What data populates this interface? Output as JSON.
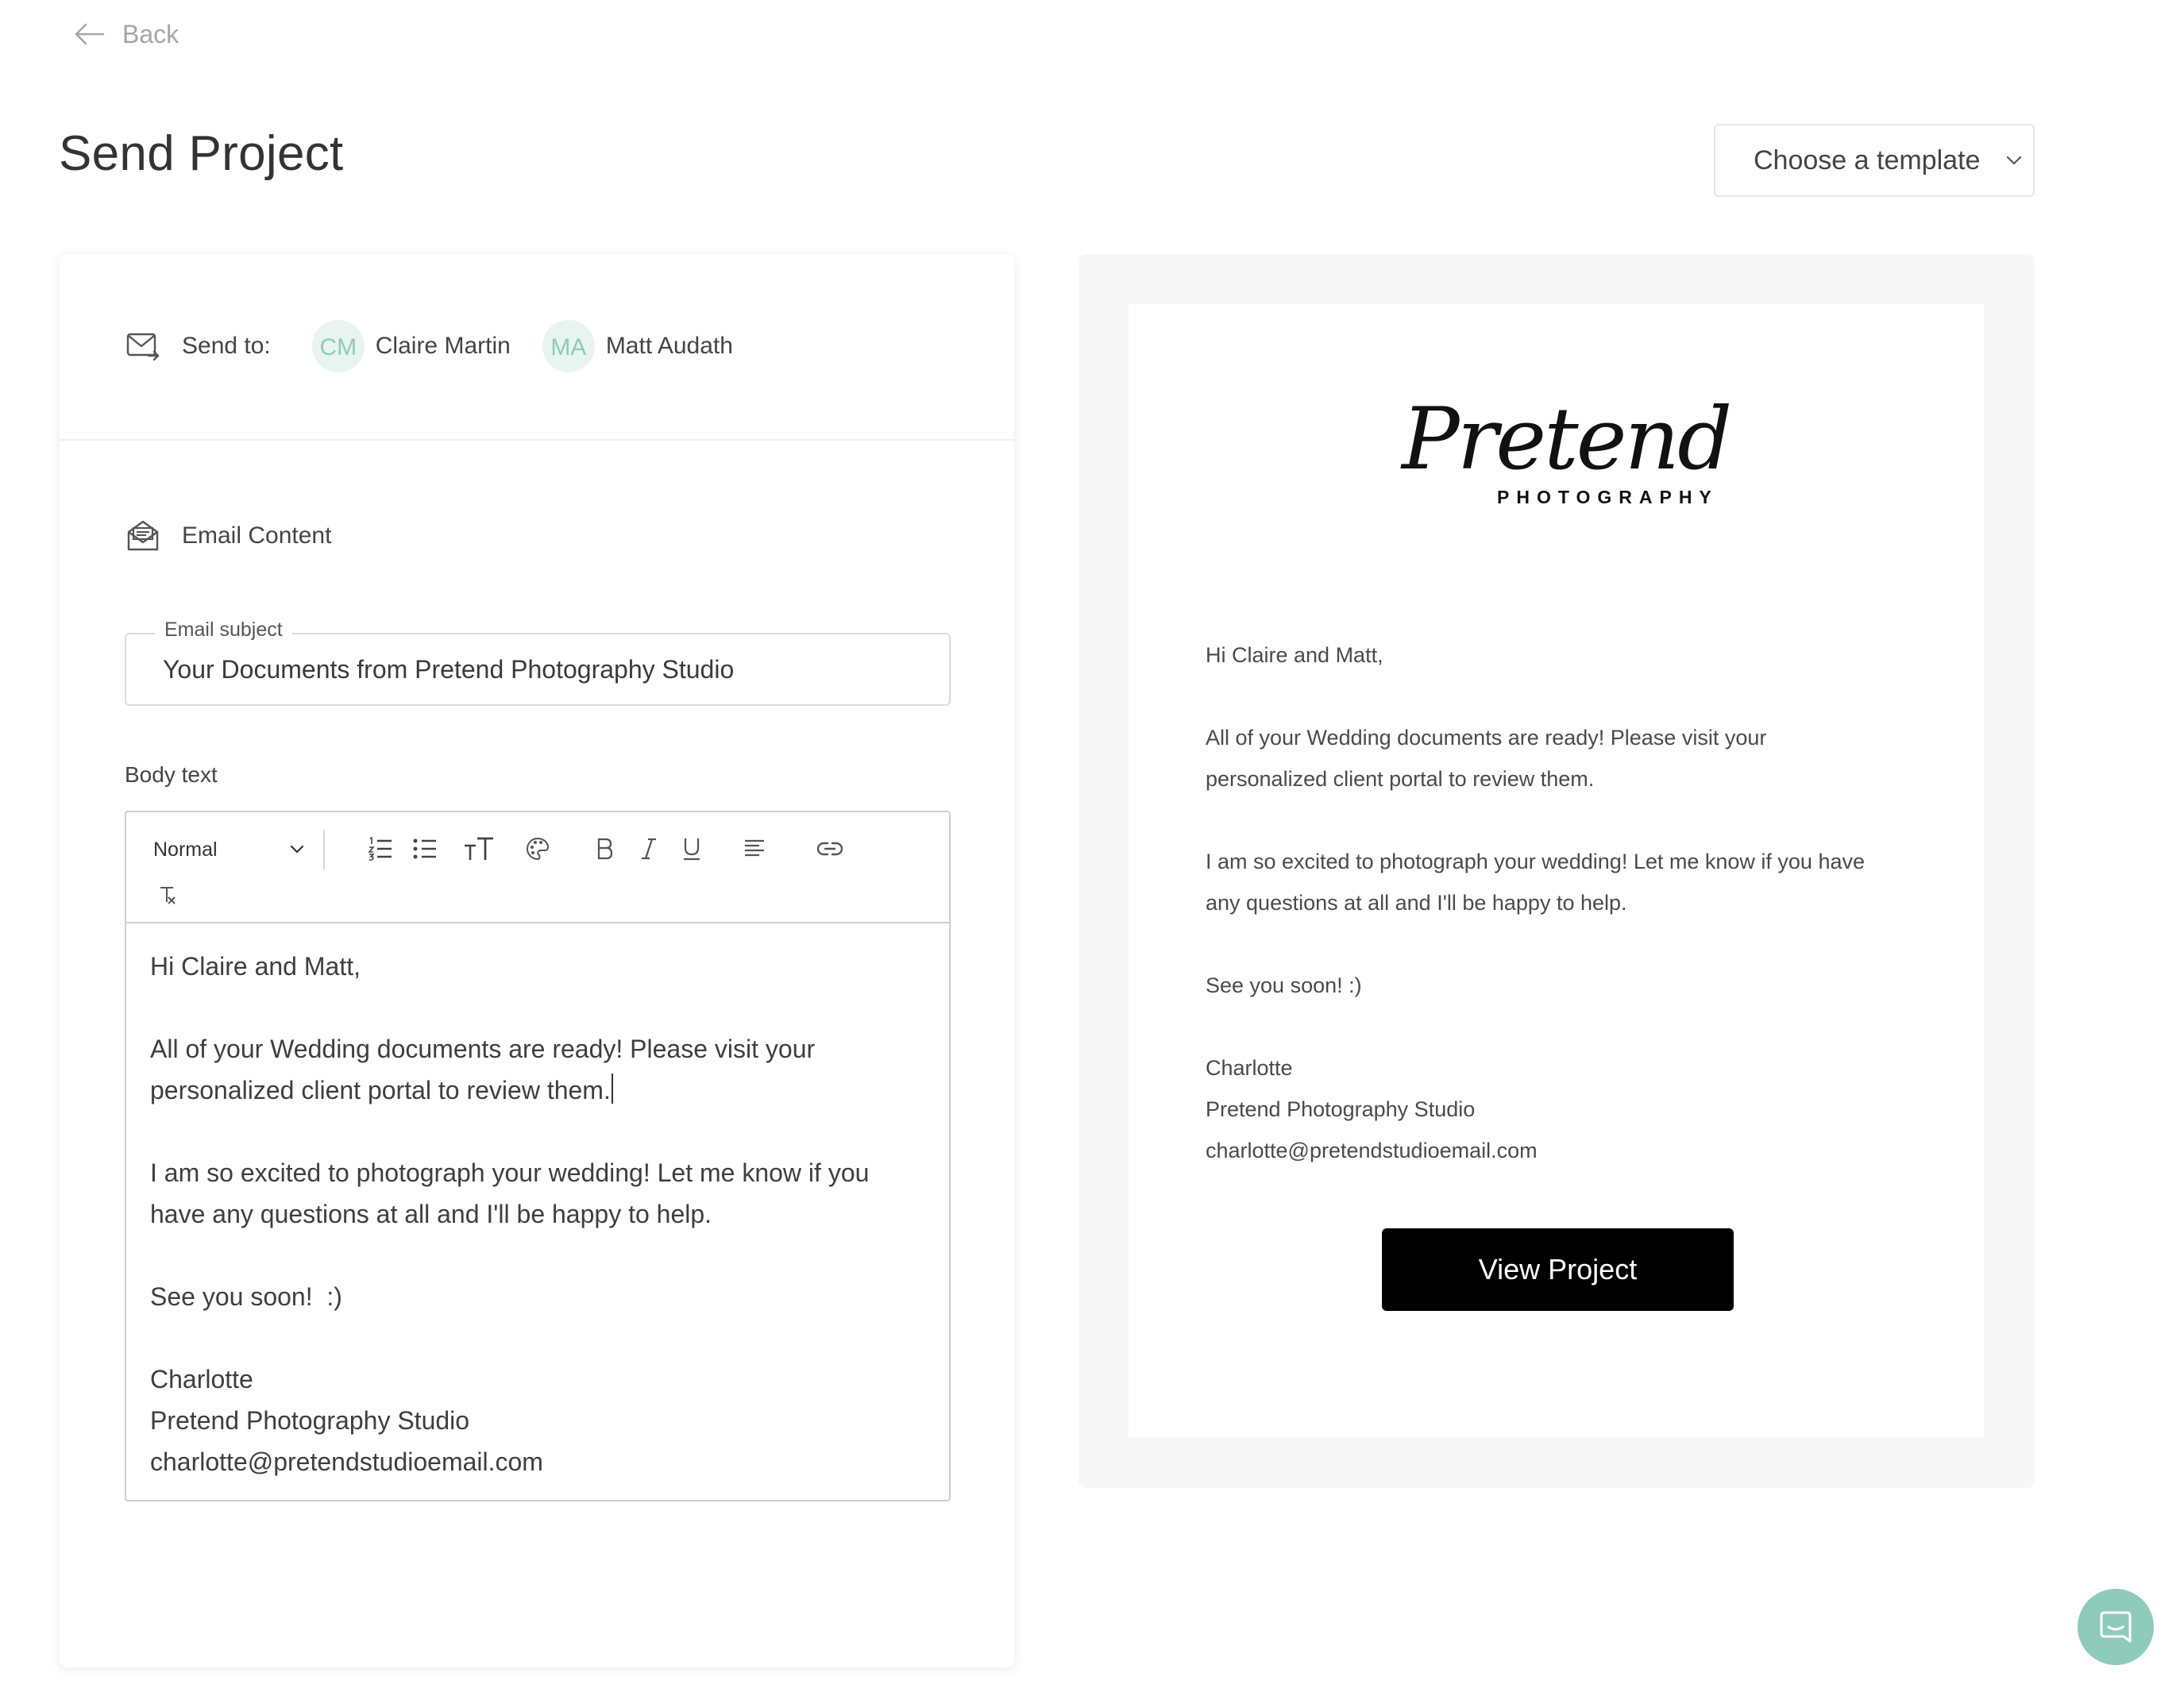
{
  "nav": {
    "back_label": "Back"
  },
  "page": {
    "title": "Send Project"
  },
  "template_select": {
    "label": "Choose a template"
  },
  "recipients": {
    "label": "Send to:",
    "items": [
      {
        "initials": "CM",
        "name": "Claire Martin"
      },
      {
        "initials": "MA",
        "name": "Matt Audath"
      }
    ]
  },
  "email_content": {
    "section_label": "Email Content",
    "subject_label": "Email subject",
    "subject_value": "Your Documents from Pretend Photography Studio",
    "body_label": "Body text",
    "format_value": "Normal"
  },
  "editor": {
    "greeting": "Hi Claire and Matt,",
    "para1_line1": "All of your Wedding documents are ready! Please visit your",
    "para1_line2": "personalized client portal to review them.",
    "para2_line1": "I am so excited to photograph your wedding! Let me know if you",
    "para2_line2": "have any questions at all and I'll be happy to help.",
    "closing": "See you soon!  :)",
    "sig_name": "Charlotte",
    "sig_studio": "Pretend Photography Studio",
    "sig_email": "charlotte@pretendstudioemail.com"
  },
  "preview": {
    "logo_script": "Pretend",
    "logo_sub": "PHOTOGRAPHY",
    "greeting": "Hi Claire and Matt,",
    "para1_line1": "All of your Wedding documents are ready! Please visit your",
    "para1_line2": "personalized client portal to review them.",
    "para2_line1": "I am so excited to photograph your wedding! Let me know if you have",
    "para2_line2": "any questions at all and I'll be happy to help.",
    "closing": "See you soon! :)",
    "sig_name": "Charlotte",
    "sig_studio": "Pretend Photography Studio",
    "sig_email": "charlotte@pretendstudioemail.com",
    "button_label": "View Project"
  },
  "colors": {
    "accent": "#8ECBBB",
    "avatar_bg": "#E7F4EF",
    "button_bg": "#000000",
    "preview_bg": "#F7F7F7"
  }
}
